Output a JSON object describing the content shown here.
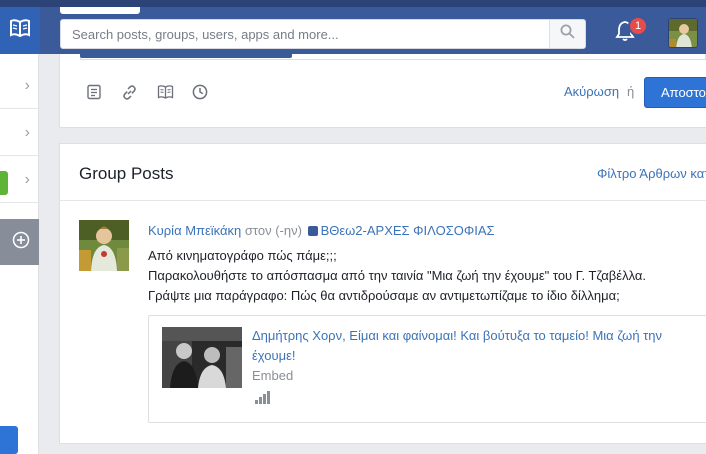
{
  "topbar": {
    "search_placeholder": "Search posts, groups, users, apps and more...",
    "notification_count": "1",
    "colors": {
      "bar": "#3b5a9a",
      "logo_tile": "#3063b5",
      "badge": "#e74c4c"
    },
    "icons": {
      "logo": "book-icon",
      "search": "search-icon",
      "bell": "bell-icon"
    }
  },
  "sidebar": {
    "icons": [
      "chevron-right-icon",
      "chevron-right-icon",
      "chevron-right-icon",
      "plus-circle-icon"
    ]
  },
  "composer": {
    "tool_icons": [
      "note-icon",
      "link-icon",
      "book-icon",
      "clock-icon"
    ],
    "cancel_label": "Ακύρωση",
    "or_label": "ή",
    "submit_label": "Αποστολή"
  },
  "group_posts": {
    "title": "Group Posts",
    "filter_label": "Φίλτρο Άρθρων κατά",
    "post": {
      "author": "Κυρία Μπεϊκάκη",
      "in_text": "στον (-ην)",
      "group": "ΒΘεω2-ΑΡΧΕΣ ΦΙΛΟΣΟΦΙΑΣ",
      "lines": [
        "Από κινηματογράφο πώς πάμε;;;",
        "Παρακολουθήστε το απόσπασμα από την ταινία \"Μια ζωή την έχουμε\" του Γ. Τζαβέλλα.",
        "Γράψτε μια παράγραφο: Πώς θα αντιδρούσαμε αν αντιμετωπίζαμε το ίδιο δίλλημα;"
      ],
      "embed": {
        "title": "Δημήτρης Χορν, Είμαι και φαίνομαι! Και βούτυξα το ταμείο! Μια ζωή την έχουμε!",
        "source": "Embed",
        "signal_icon": "signal-bars-icon"
      }
    }
  }
}
